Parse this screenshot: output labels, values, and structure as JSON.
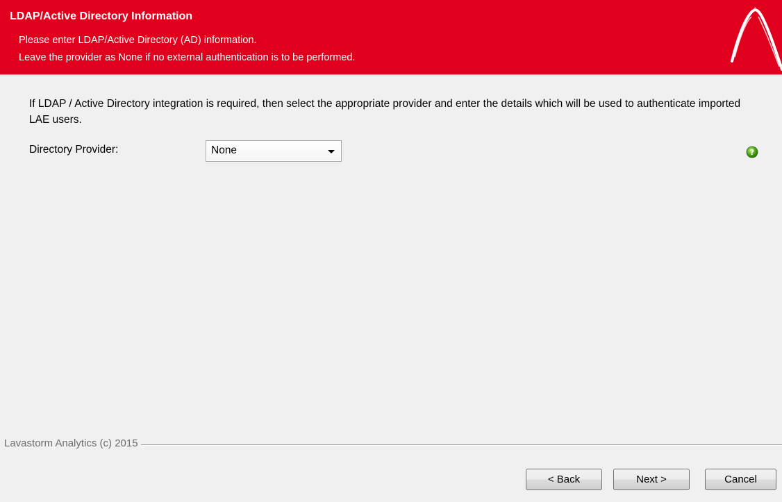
{
  "header": {
    "title": "LDAP/Active Directory Information",
    "subtitle_line1": "Please enter LDAP/Active Directory (AD) information.",
    "subtitle_line2": "Leave the provider as None if no external authentication is to be performed.",
    "background_color": "#e0001d",
    "logo_icon": "lavastorm-logo-icon"
  },
  "main": {
    "intro_text": "If LDAP / Active Directory integration is required, then select the appropriate provider and enter the details which will be used to authenticate imported LAE users.",
    "provider_label": "Directory Provider:",
    "provider_selected": "None",
    "help_icon": "help-icon"
  },
  "footer": {
    "brand": "Lavastorm Analytics (c) 2015",
    "back_label": "< Back",
    "next_label": "Next >",
    "cancel_label": "Cancel"
  }
}
